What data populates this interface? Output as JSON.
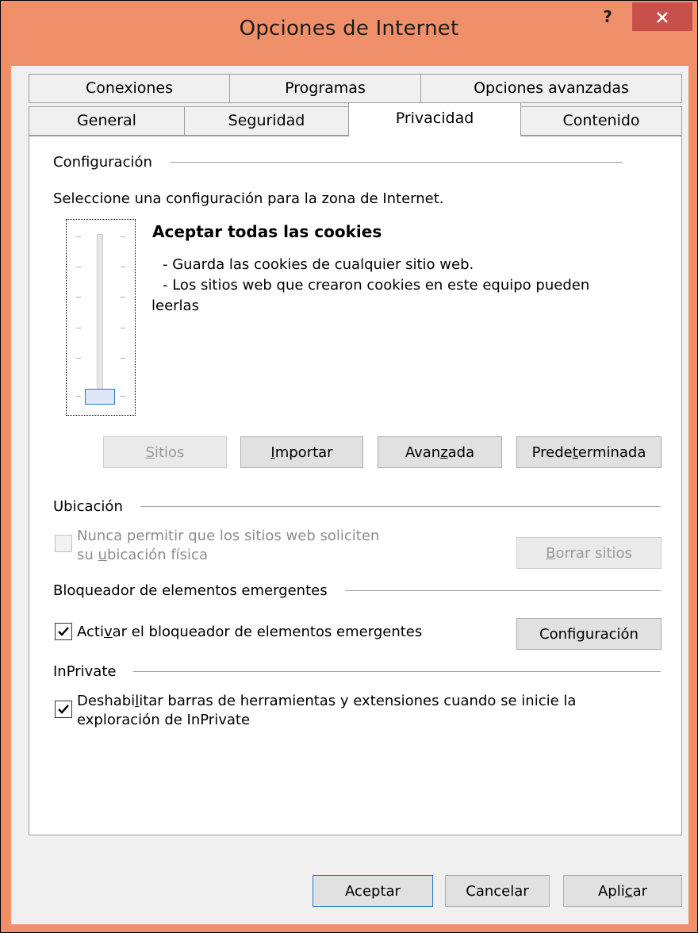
{
  "window": {
    "title": "Opciones de Internet",
    "help_glyph": "?"
  },
  "tabs_row1": [
    {
      "label": "Conexiones"
    },
    {
      "label": "Programas"
    },
    {
      "label": "Opciones avanzadas"
    }
  ],
  "tabs_row2": [
    {
      "label": "General"
    },
    {
      "label": "Seguridad"
    },
    {
      "label": "Privacidad"
    },
    {
      "label": "Contenido"
    }
  ],
  "active_tab": "Privacidad",
  "config": {
    "header": "Configuración",
    "instruction": "Seleccione una configuración para la zona de Internet.",
    "level_title": "Aceptar todas las cookies",
    "desc_line1": "- Guarda las cookies de cualquier sitio web.",
    "desc_line2": "- Los sitios web que crearon cookies en este equipo pueden",
    "desc_line3": "leerlas",
    "slider_level": 0,
    "slider_levels_total": 6,
    "buttons": {
      "sites": {
        "pre": "",
        "key": "S",
        "post": "itios"
      },
      "import": {
        "pre": "",
        "key": "I",
        "post": "mportar"
      },
      "advanced": {
        "pre": "Avan",
        "key": "z",
        "post": "ada"
      },
      "default": {
        "pre": "Prede",
        "key": "t",
        "post": "erminada"
      }
    }
  },
  "location": {
    "header": "Ubicación",
    "checkbox_line1": "Nunca permitir que los sitios web soliciten",
    "checkbox_line2_pre": "su ",
    "checkbox_line2_key": "u",
    "checkbox_line2_post": "bicación física",
    "checked": false,
    "clear_button": {
      "pre": "",
      "key": "B",
      "post": "orrar sitios"
    }
  },
  "popup": {
    "header": "Bloqueador de elementos emergentes",
    "checkbox_pre": "Acti",
    "checkbox_key": "v",
    "checkbox_post": "ar el bloqueador de elementos emergentes",
    "checked": true,
    "settings_button": {
      "pre": "Confi",
      "key": "g",
      "post": "uración"
    }
  },
  "inprivate": {
    "header": "InPrivate",
    "checkbox_line1_pre": "Deshabi",
    "checkbox_line1_key": "l",
    "checkbox_line1_post": "itar barras de herramientas y extensiones cuando se inicie la",
    "checkbox_line2": "exploración de InPrivate",
    "checked": true
  },
  "footer": {
    "ok": {
      "pre": "Aceptar",
      "key": "",
      "post": ""
    },
    "cancel": {
      "pre": "Cancelar",
      "key": "",
      "post": ""
    },
    "apply": {
      "pre": "Apli",
      "key": "c",
      "post": "ar"
    }
  },
  "colors": {
    "titlebar": "#f0906a",
    "close_button": "#c7504a",
    "focus_border": "#2a78d6"
  }
}
